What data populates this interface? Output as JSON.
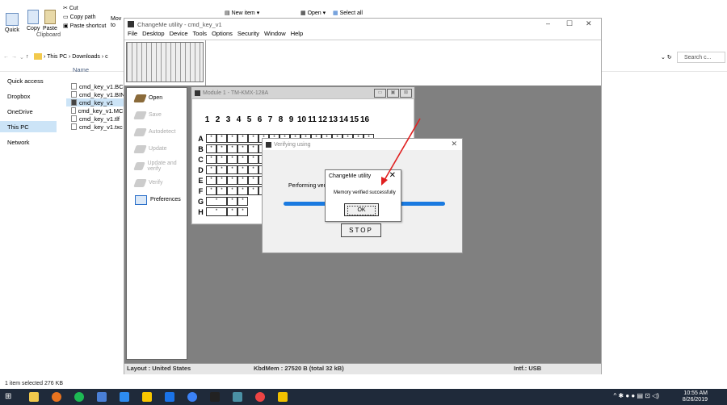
{
  "explorer": {
    "ribbon": {
      "quick_access": "Quick",
      "copy": "Copy",
      "paste": "Paste",
      "cut": "Cut",
      "copy_path": "Copy path",
      "paste_shortcut": "Paste shortcut",
      "move_to": "Mov to",
      "clipboard": "Clipboard",
      "new_item": "New item",
      "open": "Open",
      "select_all": "Select all"
    },
    "address": {
      "path": "› This PC › Downloads › c",
      "search_placeholder": "Search c..."
    },
    "nav": [
      "Quick access",
      "Dropbox",
      "OneDrive",
      "This PC",
      "Network"
    ],
    "column_name": "Name",
    "files": [
      "cmd_key_v1.BC1",
      "cmd_key_v1.BIN",
      "cmd_key_v1",
      "cmd_key_v1.MCF",
      "cmd_key_v1.tlf",
      "cmd_key_v1.txc"
    ],
    "status": "1 item selected  276 KB"
  },
  "app": {
    "title": "ChangeMe utility - cmd_key_v1",
    "menu": [
      "File",
      "Desktop",
      "Device",
      "Tools",
      "Options",
      "Security",
      "Window",
      "Help"
    ],
    "sidebar": [
      "Open",
      "Save",
      "Autodetect",
      "Update",
      "Update and verify",
      "Verify",
      "Preferences"
    ],
    "statusbar": {
      "layout": "Layout : United States",
      "kbdmem": "KbdMem : 27520 B  (total 32 kB)",
      "intf": "Intf.: USB"
    }
  },
  "module": {
    "title": "Module 1 - TM-KMX-128A",
    "columns": [
      "1",
      "2",
      "3",
      "4",
      "5",
      "6",
      "7",
      "8",
      "9",
      "10",
      "11",
      "12",
      "13",
      "14",
      "15",
      "16"
    ],
    "rows": [
      "A",
      "B",
      "C",
      "D",
      "E",
      "F",
      "G",
      "H"
    ],
    "cell_mark": "*"
  },
  "verify": {
    "title": "Verifying using",
    "text": "Performing verify",
    "stop": "STOP"
  },
  "message": {
    "title": "ChangeMe utility",
    "text": "Memory verified successfully",
    "ok": "OK"
  },
  "taskbar": {
    "time": "10:55 AM",
    "date": "8/26/2019"
  },
  "colors": {
    "progress": "#1a7ae0",
    "annotation_arrow": "#e02020",
    "taskbar": "#1f2a3a"
  }
}
